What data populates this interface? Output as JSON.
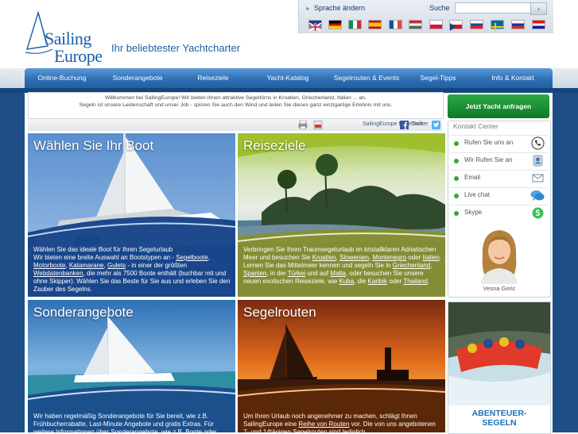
{
  "brand": {
    "logo_line1": "Sailing",
    "logo_line2": "Europe",
    "tagline": "Ihr beliebtester Yachtcharter"
  },
  "topbar": {
    "language_link": "Sprache ändern",
    "search_label": "Suche",
    "search_placeholder": "",
    "search_button": "›",
    "flags": [
      {
        "name": "flag-uk-icon"
      },
      {
        "name": "flag-germany-icon"
      },
      {
        "name": "flag-italy-icon"
      },
      {
        "name": "flag-spain-icon"
      },
      {
        "name": "flag-france-icon"
      },
      {
        "name": "flag-hungary-icon"
      },
      {
        "name": "flag-poland-icon"
      },
      {
        "name": "flag-czech-icon"
      },
      {
        "name": "flag-slovakia-icon"
      },
      {
        "name": "flag-sweden-icon"
      },
      {
        "name": "flag-russia-icon"
      },
      {
        "name": "flag-croatia-icon"
      }
    ]
  },
  "nav": {
    "items": [
      "Online-Buchung",
      "Sonderangebote",
      "Reiseziele",
      "Yacht-Katalog",
      "Segelrouten & Events",
      "Segel-Tipps",
      "Info & Kontakt"
    ]
  },
  "welcome": {
    "line1": "Willkommen bei SailingEurope! Wir bieten Ihnen attraktive Segeltörns in Kroatien, Griechenland, Italien ... an.",
    "line2": "Segeln ist unsere Leidenschaft und unser Job - spüren Sie auch den Wind und teilen Sie dieses ganz einzigartige Erlebnis mit uns."
  },
  "cta": {
    "label": "Jetzt Yacht anfragen"
  },
  "toolbar": {
    "facebook": "SailingEurope Facebook",
    "twitter": "Twitter"
  },
  "cards": {
    "boot": {
      "title": "Wählen Sie Ihr Boot",
      "t1": "Wählen Sie das ideale Boot für Ihren Segelurlaub",
      "t2": "Wir bieten eine breite Auswahl an Bootstypen an - ",
      "l1": "Segelboote",
      "l2": "Motorboote",
      "l3": "Katamarane",
      "l4": "Gulets",
      "t3": " - in einer der größten",
      "l5": "Webdatenbanken",
      "t4": ", die mehr als 7500 Boote enthält (buchbar mit und ohne Skipper). Wählen Sie das Beste für Sie aus und erleben Sie den Zauber des Segelns."
    },
    "reiseziele": {
      "title": "Reiseziele",
      "t1": "Verbringen Sie Ihren Traumsegelurlaub im kristallklaren Adriatischen Meer und besuchen Sie ",
      "l1": "Kroatien",
      "l2": "Slowenien",
      "l3": "Montenegro",
      "t2": " oder ",
      "l4": "Italien",
      "t3": ". Lernen Sie das Mittelmeer kennen und segeln Sie in ",
      "l5": "Griechenland",
      "l6": "Spanien",
      "t4": ", in der ",
      "l7": "Türkei",
      "t5": " und auf ",
      "l8": "Malta",
      "t6": ", oder besuchen Sie unsere neuen exotischen Reiseziele, wie ",
      "l9": "Kuba",
      "t7": ", die ",
      "l10": "Karibik",
      "t8": " oder ",
      "l11": "Thailand",
      "t9": "."
    },
    "sonder": {
      "title": "Sonderangebote",
      "text": "Wir haben regelmäßig Sonderangebote für Sie bereit, wie z.B. Frühbucherrabatte, Last-Minute Angebote und gratis Extras. Für weitere Informationen über Sonderangebote, wie z.B. Boote oder"
    },
    "segelrouten": {
      "title": "Segelrouten",
      "t1": "Um Ihren Urlaub noch angenehmer zu machen, schlägt Ihnen SailingEurope eine ",
      "l1": "Reihe von Routen",
      "t2": " vor. Die von uns angebotenen 7- und 14tägigen Segelrouten sind lediglich"
    }
  },
  "contact": {
    "title": "Kontakt Center",
    "rows": [
      {
        "label": "Rufen Sie uns an",
        "icon": "phone-icon"
      },
      {
        "label": "Wir Rufen Sie an",
        "icon": "callback-icon"
      },
      {
        "label": "Email",
        "icon": "email-icon"
      },
      {
        "label": "Live chat",
        "icon": "chat-icon"
      },
      {
        "label": "Skype",
        "icon": "skype-icon"
      }
    ],
    "agent": "Vesna Geric"
  },
  "adventure": {
    "line1": "ABENTEUER-",
    "line2": "SEGELN"
  },
  "colors": {
    "brand_blue": "#1b5fa6",
    "nav_blue": "#2e6fb5",
    "cta_green": "#1a8f33",
    "page_dark": "#1d4e86"
  }
}
